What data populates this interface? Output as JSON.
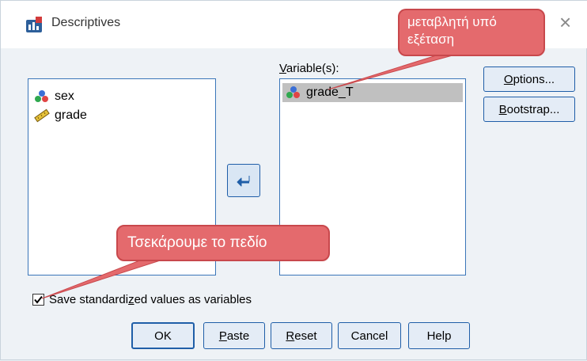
{
  "window": {
    "title": "Descriptives",
    "close_symbol": "×"
  },
  "source_list": {
    "items": [
      {
        "label": "sex",
        "icon": "nominal-variable-icon"
      },
      {
        "label": "grade",
        "icon": "scale-variable-icon"
      }
    ]
  },
  "target_list": {
    "label_prefix": "",
    "label_mnemonic": "V",
    "label_rest": "ariable(s):",
    "items": [
      {
        "label": "grade_T",
        "icon": "nominal-variable-icon",
        "selected": true
      }
    ]
  },
  "buttons": {
    "options": {
      "mnemonic": "O",
      "rest": "ptions..."
    },
    "bootstrap": {
      "mnemonic": "B",
      "rest": "ootstrap..."
    },
    "move_symbol": "arrow-left-icon",
    "ok": "OK",
    "paste": {
      "mnemonic": "P",
      "rest": "aste"
    },
    "reset": {
      "mnemonic": "R",
      "rest": "eset"
    },
    "cancel": "Cancel",
    "help": "Help"
  },
  "checkbox": {
    "checked": true,
    "label_before": "Save standardi",
    "label_mnemonic": "z",
    "label_after": "ed values as variables"
  },
  "annotations": {
    "top": "μεταβλητή υπό εξέταση",
    "bottom": "Τσεκάρουμε το πεδίο"
  },
  "colors": {
    "accent": "#1f5ea8",
    "callout": "#e46a6d"
  }
}
